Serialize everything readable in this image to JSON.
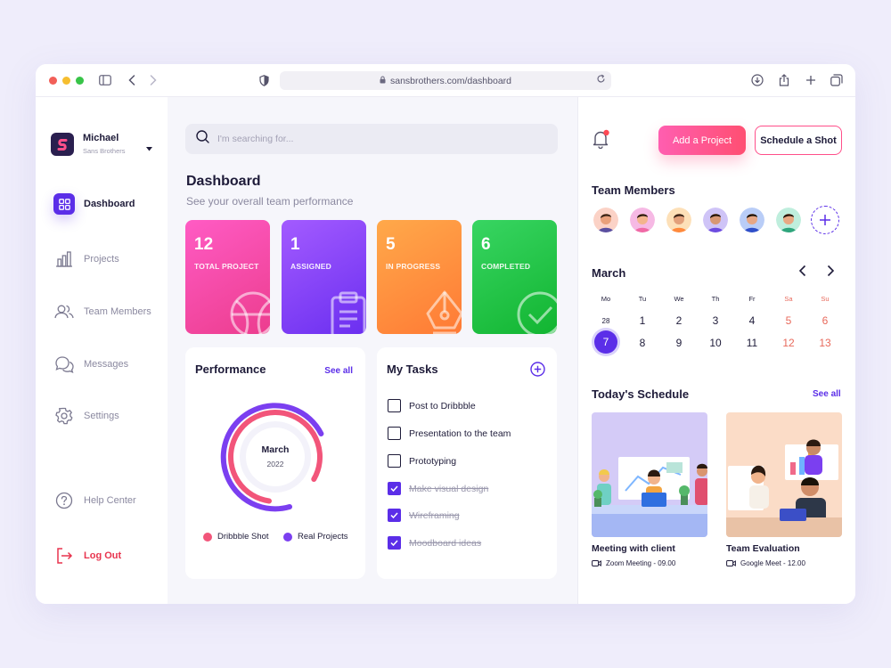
{
  "browser": {
    "url": "sansbrothers.com/dashboard"
  },
  "profile": {
    "name": "Michael",
    "company": "Sans Brothers"
  },
  "sidebar": {
    "items": [
      {
        "label": "Dashboard",
        "icon": "grid-icon",
        "active": true
      },
      {
        "label": "Projects",
        "icon": "bar-chart-icon"
      },
      {
        "label": "Team Members",
        "icon": "users-icon"
      },
      {
        "label": "Messages",
        "icon": "chat-icon"
      },
      {
        "label": "Settings",
        "icon": "gear-icon"
      }
    ],
    "help": "Help Center",
    "logout": "Log Out"
  },
  "search": {
    "placeholder": "I'm searching for..."
  },
  "header": {
    "title": "Dashboard",
    "subtitle": "See your overall team performance"
  },
  "stats": [
    {
      "value": "12",
      "label": "TOTAL PROJECT",
      "color": "#f545a9"
    },
    {
      "value": "1",
      "label": "ASSIGNED",
      "color": "#8544f7"
    },
    {
      "value": "5",
      "label": "IN PROGRESS",
      "color": "#ff8f3f"
    },
    {
      "value": "6",
      "label": "COMPLETED",
      "color": "#22c447"
    }
  ],
  "performance": {
    "title": "Performance",
    "see_all": "See all",
    "month": "March",
    "year": "2022",
    "legend": [
      {
        "label": "Dribbble Shot",
        "color": "#f2557a"
      },
      {
        "label": "Real Projects",
        "color": "#7b3ff0"
      }
    ]
  },
  "tasks": {
    "title": "My Tasks",
    "items": [
      {
        "label": "Post to Dribbble",
        "done": false
      },
      {
        "label": "Presentation to the team",
        "done": false
      },
      {
        "label": "Prototyping",
        "done": false
      },
      {
        "label": "Make visual design",
        "done": true
      },
      {
        "label": "Wireframing",
        "done": true
      },
      {
        "label": "Moodboard ideas",
        "done": true
      }
    ]
  },
  "actions": {
    "add_project": "Add a Project",
    "schedule_shot": "Schedule a Shot"
  },
  "team": {
    "title": "Team Members"
  },
  "calendar": {
    "month": "March",
    "weekdays": [
      "Mo",
      "Tu",
      "We",
      "Th",
      "Fr",
      "Sa",
      "Su"
    ],
    "week1": [
      "28",
      "1",
      "2",
      "3",
      "4",
      "5",
      "6"
    ],
    "week2": [
      "7",
      "8",
      "9",
      "10",
      "11",
      "12",
      "13"
    ],
    "selected": "7"
  },
  "schedule": {
    "title": "Today's Schedule",
    "see_all": "See all",
    "items": [
      {
        "title": "Meeting with client",
        "meta": "Zoom Meeting - 09.00"
      },
      {
        "title": "Team Evaluation",
        "meta": "Google Meet - 12.00"
      }
    ]
  }
}
